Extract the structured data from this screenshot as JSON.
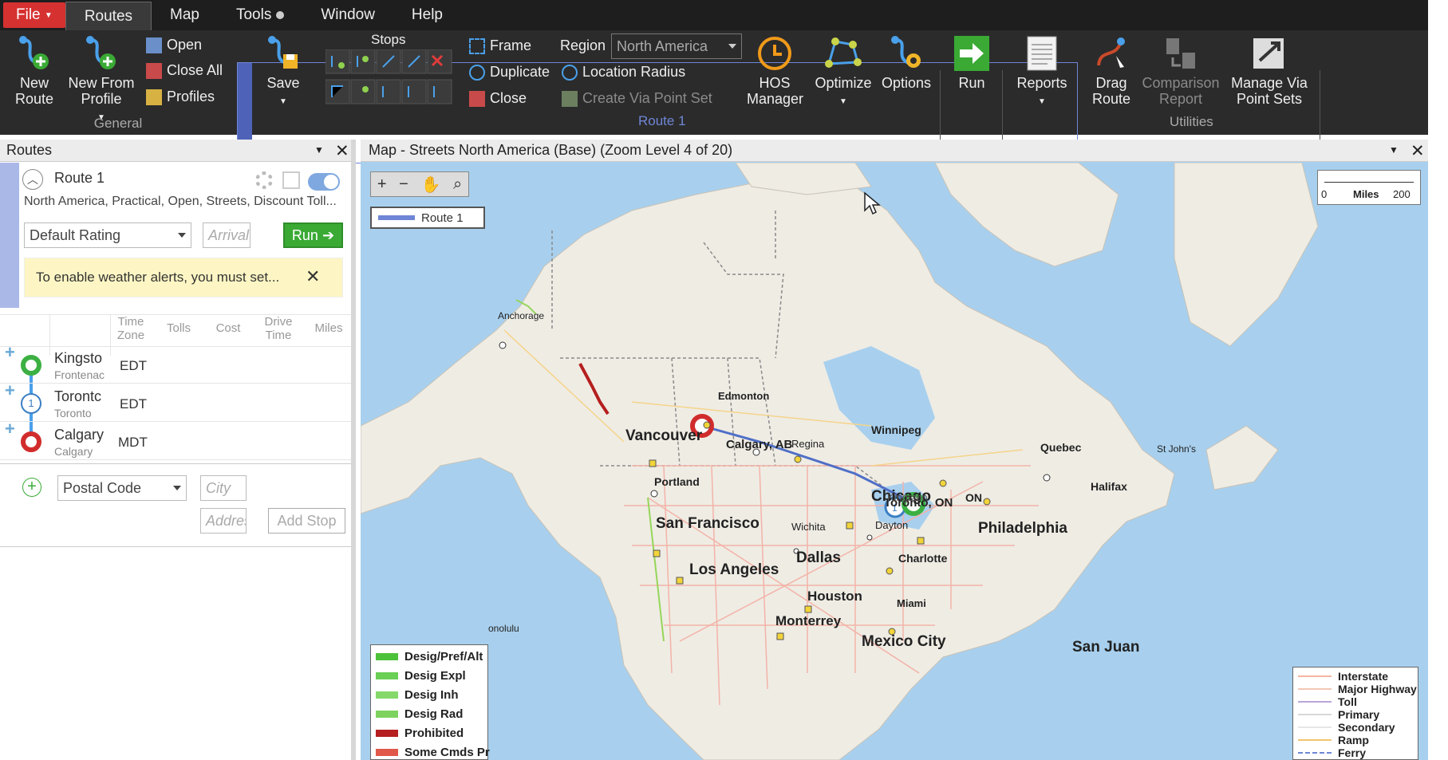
{
  "menu": {
    "file": "File",
    "routes": "Routes",
    "map": "Map",
    "tools": "Tools",
    "window": "Window",
    "help": "Help"
  },
  "ribbon": {
    "general": {
      "label": "General",
      "new_route": "New Route",
      "new_from_profile": "New From Profile",
      "open": "Open",
      "close_all": "Close All",
      "profiles": "Profiles"
    },
    "route1": {
      "label": "Route 1",
      "save": "Save",
      "stops": "Stops",
      "frame": "Frame",
      "duplicate": "Duplicate",
      "close": "Close",
      "region_label": "Region",
      "region_value": "North America",
      "location_radius": "Location Radius",
      "create_via": "Create Via Point Set",
      "hos": "HOS Manager",
      "optimize": "Optimize",
      "options": "Options",
      "run": "Run",
      "reports": "Reports"
    },
    "utilities": {
      "label": "Utilities",
      "drag_route": "Drag Route",
      "comparison_report": "Comparison Report",
      "manage_via": "Manage Via Point Sets"
    }
  },
  "routes_panel": {
    "title": "Routes",
    "route_name": "Route 1",
    "route_desc": "North America, Practical, Open, Streets, Discount Toll...",
    "rating": "Default Rating",
    "arrival_placeholder": "Arrival",
    "run": "Run",
    "weather_alert": "To enable weather alerts, you must set...",
    "columns": [
      "Time Zone",
      "Tolls",
      "Cost",
      "Drive Time",
      "Miles"
    ],
    "stops": [
      {
        "name": "Kingsto",
        "sub": "Frontenac",
        "tz": "EDT"
      },
      {
        "name": "Torontc",
        "sub": "Toronto",
        "tz": "EDT"
      },
      {
        "name": "Calgary",
        "sub": "Calgary",
        "tz": "MDT"
      }
    ],
    "stop_marker_1": "1",
    "postal": "Postal Code",
    "city_placeholder": "City",
    "address_placeholder": "Addres",
    "add_stop": "Add Stop"
  },
  "map_panel": {
    "title": "Map - Streets North America (Base) (Zoom Level 4 of 20)",
    "route_legend": "Route 1",
    "scale_min": "0",
    "scale_unit": "Miles",
    "scale_max": "200",
    "cities": [
      "Anchorage",
      "Edmonton",
      "Vancouver",
      "Calgary, AB",
      "Regina",
      "Winnipeg",
      "Portland",
      "Chicago",
      "Quebec",
      "St John's",
      "Halifax",
      "Toronto, ON",
      "ON",
      "Kingston",
      "Philadelphia",
      "San Francisco",
      "Wichita",
      "Dayton",
      "Dallas",
      "Charlotte",
      "Los Angeles",
      "Houston",
      "Miami",
      "Monterrey",
      "Mexico City",
      "San Juan",
      "onolulu"
    ],
    "legend_left": [
      "Desig/Pref/Alt",
      "Desig Expl",
      "Desig Inh",
      "Desig Rad",
      "Prohibited",
      "Some Cmds Pr"
    ],
    "legend_right": [
      "Interstate",
      "Major Highway",
      "Toll",
      "Primary",
      "Secondary",
      "Ramp",
      "Ferry"
    ]
  },
  "colors": {
    "accent": "#4e63b7",
    "run_green": "#3aaa35",
    "file_red": "#d63131",
    "stop_green": "#3cb043",
    "stop_red": "#d12c2c",
    "stop_blue": "#3b7fc4"
  }
}
